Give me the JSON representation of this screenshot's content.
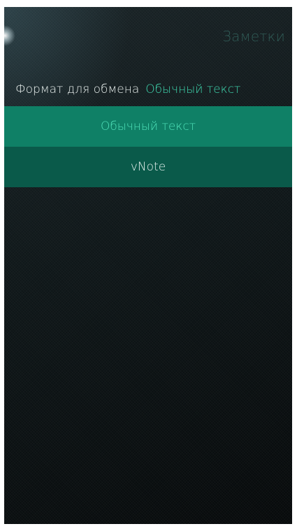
{
  "page": {
    "header_title": "Заметки"
  },
  "combo": {
    "label": "Формат для обмена",
    "value": "Обычный текст"
  },
  "menu": {
    "items": [
      {
        "label": "Обычный текст",
        "selected": true
      },
      {
        "label": "vNote",
        "selected": false
      }
    ]
  },
  "colors": {
    "accent": "#3fd6ae",
    "menu_selected_bg": "#0f8066",
    "menu_bg": "#0a5a4a",
    "header": "#2f5a55"
  }
}
